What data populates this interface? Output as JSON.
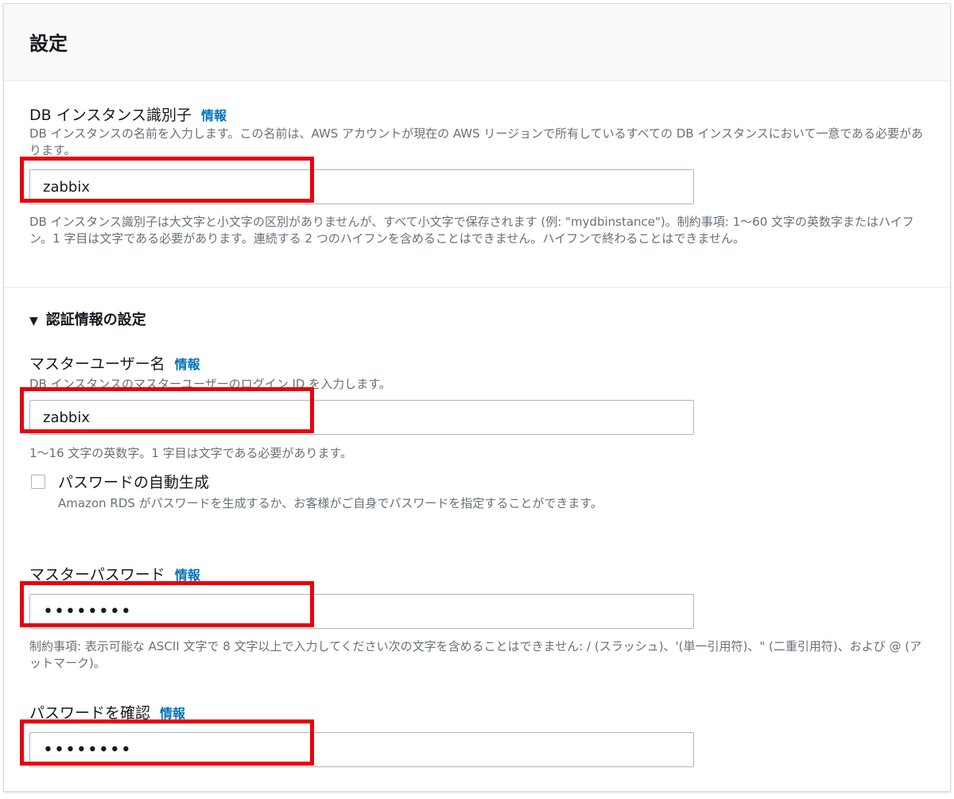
{
  "panel": {
    "title": "設定"
  },
  "db_identifier": {
    "label": "DB インスタンス識別子",
    "info": "情報",
    "description": "DB インスタンスの名前を入力します。この名前は、AWS アカウントが現在の AWS リージョンで所有しているすべての DB インスタンスにおいて一意である必要があります。",
    "value": "zabbix",
    "constraint": "DB インスタンス識別子は大文字と小文字の区別がありませんが、すべて小文字で保存されます (例: \"mydbinstance\")。制約事項: 1～60 文字の英数字またはハイフン。1 字目は文字である必要があります。連続する 2 つのハイフンを含めることはできません。ハイフンで終わることはできません。"
  },
  "credentials": {
    "section_label": "認証情報の設定",
    "master_username": {
      "label": "マスターユーザー名",
      "info": "情報",
      "description": "DB インスタンスのマスターユーザーのログイン ID を入力します。",
      "value": "zabbix",
      "constraint": "1～16 文字の英数字。1 字目は文字である必要があります。"
    },
    "auto_generate": {
      "label": "パスワードの自動生成",
      "checked": false,
      "description": "Amazon RDS がパスワードを生成するか、お客様がご自身でパスワードを指定することができます。"
    },
    "master_password": {
      "label": "マスターパスワード",
      "info": "情報",
      "value": "••••••••",
      "constraint": "制約事項: 表示可能な ASCII 文字で 8 文字以上で入力してください次の文字を含めることはできません: / (スラッシュ)、'(単一引用符)、\" (二重引用符)、および @ (アットマーク)。"
    },
    "confirm_password": {
      "label": "パスワードを確認",
      "info": "情報",
      "value": "••••••••"
    }
  },
  "colors": {
    "highlight": "#e8000b",
    "link": "#0073bb",
    "muted": "#687078"
  }
}
